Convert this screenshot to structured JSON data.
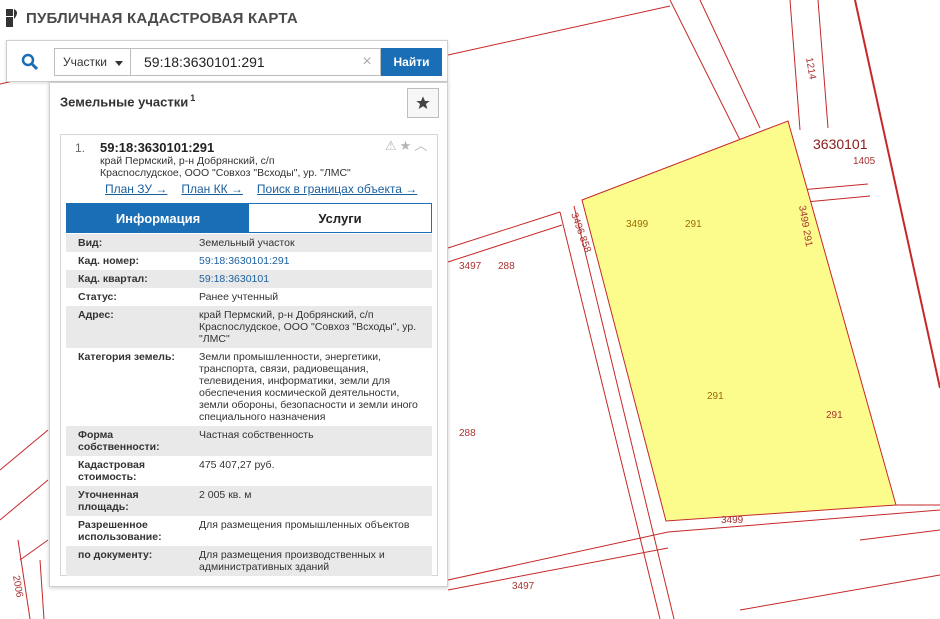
{
  "header": {
    "title": "ПУБЛИЧНАЯ КАДАСТРОВАЯ КАРТА"
  },
  "search": {
    "type_label": "Участки",
    "value": "59:18:3630101:291",
    "button_label": "Найти"
  },
  "panel": {
    "title": "Земельные участки",
    "count": "1"
  },
  "result": {
    "index": "1.",
    "number": "59:18:3630101:291",
    "address_lines": [
      "край Пермский, р-н Добрянский, с/п",
      "Красnoслудское, ООО \"Совхоз \"Всходы\", ур. \"ЛМС\""
    ],
    "links": [
      "План ЗУ →",
      "План КК →",
      "Поиск в границах объекта →"
    ]
  },
  "tabs": [
    "Информация",
    "Услуги"
  ],
  "info_rows": [
    {
      "key": "Вид:",
      "value": "Земельный участок"
    },
    {
      "key": "Кад. номер:",
      "value": "59:18:3630101:291"
    },
    {
      "key": "Кад. квартал:",
      "value": "59:18:3630101"
    },
    {
      "key": "Статус:",
      "value": "Ранее учтенный"
    },
    {
      "key": "Адрес:",
      "value": "край Пермский, р-н Добрянский, с/п Красnoслудское, ООО \"Совхоз \"Всходы\", ур. \"ЛМС\""
    },
    {
      "key": "Категория земель:",
      "value": "Земли промышленности, энергетики, транспорта, связи, радиовещания, телевидения, информатики, земли для обеспечения космической деятельности, земли обороны, безопасности и земли иного специального назначения"
    },
    {
      "key": "Форма собственности:",
      "value": "Частная собственность"
    },
    {
      "key": "Кадастровая стоимость:",
      "value": "475 407,27 руб."
    },
    {
      "key": "Уточненная площадь:",
      "value": "2 005 кв. м"
    },
    {
      "key": "Разрешенное использование:",
      "value": "Для размещения промышленных объектов"
    },
    {
      "key": "по документу:",
      "value": "Для размещения производственных и административных зданий"
    }
  ],
  "map": {
    "quarter_label": "3630101",
    "labels": [
      "1214",
      "1405",
      "3499",
      "291",
      "3499",
      "291",
      "3496",
      "858",
      "3497",
      "288",
      "288",
      "291",
      "291",
      "3499",
      "3497",
      "2006"
    ],
    "parcel_fill": "#fcfc8c",
    "line_color": "#c62828"
  },
  "colors": {
    "accent": "#1a6eb5"
  }
}
